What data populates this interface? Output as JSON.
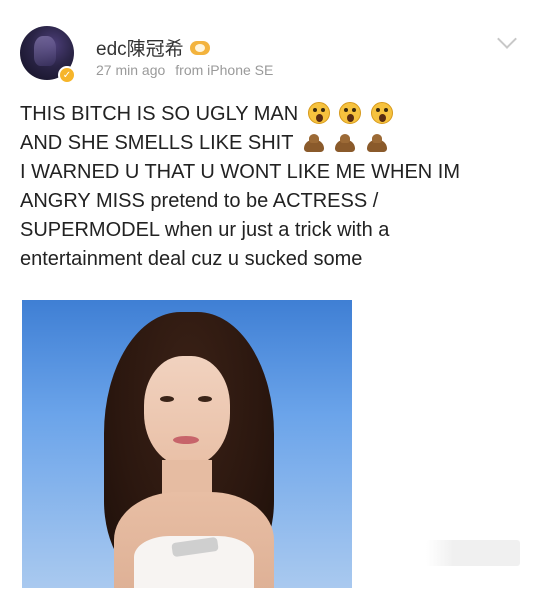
{
  "post": {
    "username": "edc陳冠希",
    "timestamp": "27 min ago",
    "source": "from iPhone SE",
    "lines": [
      {
        "text": "THIS BITCH IS SO UGLY MAN",
        "emoji": "screaming-face",
        "count": 3
      },
      {
        "text": "AND SHE SMELLS LIKE SHIT",
        "emoji": "pile-of-poo",
        "count": 3
      },
      {
        "text": "I WARNED U THAT U WONT LIKE ME WHEN IM"
      },
      {
        "text": "ANGRY MISS pretend to be ACTRESS /"
      },
      {
        "text": "SUPERMODEL when ur just a trick with a"
      },
      {
        "text": "entertainment deal cuz u sucked some"
      }
    ],
    "photo": {
      "description_visible": false
    },
    "icons": {
      "avatar": "avatar-icon",
      "verified": "verified-badge-icon",
      "level": "member-level-icon",
      "menu": "chevron-down-icon"
    },
    "colors": {
      "meta_text": "#9a9a9a",
      "username_text": "#333333",
      "badge": "#f6b52a"
    }
  }
}
